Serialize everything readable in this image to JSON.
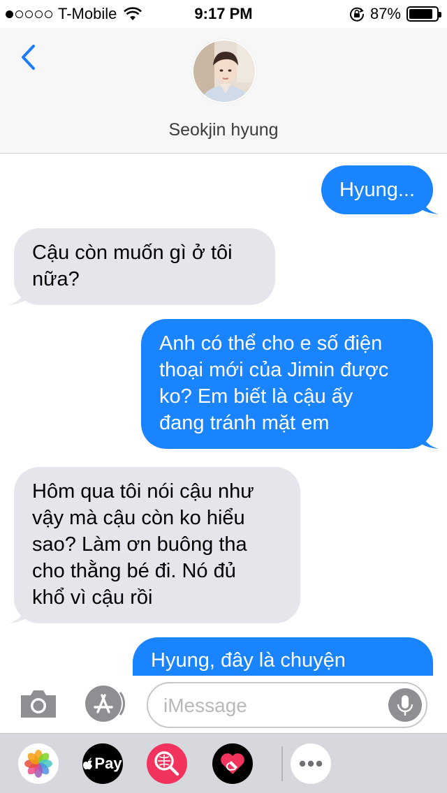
{
  "status_bar": {
    "carrier": "T-Mobile",
    "time": "9:17 PM",
    "battery": "87%",
    "battery_level": 0.87,
    "signal_bars": 1
  },
  "header": {
    "contact_name": "Seokjin hyung"
  },
  "messages": [
    {
      "direction": "out",
      "text": "Hyung..."
    },
    {
      "direction": "in",
      "text": "Cậu còn muốn gì ở tôi\nnữa?"
    },
    {
      "direction": "out",
      "text": "Anh có thể cho e số điện\nthoại mới của Jimin được\nko? Em biết là cậu ấy\nđang tránh mặt em"
    },
    {
      "direction": "in",
      "text": "Hôm qua tôi nói cậu như\nvậy mà cậu còn ko hiểu\nsao? Làm ơn buông tha\ncho thằng bé đi. Nó đủ\nkhổ vì cậu rồi"
    },
    {
      "direction": "out",
      "text": "Hyung, đây là chuyện"
    }
  ],
  "input": {
    "placeholder": "iMessage"
  },
  "app_drawer": {
    "apple_pay_label": "Pay",
    "icons": [
      "photos-icon",
      "apple-pay-icon",
      "web-search-icon",
      "digital-touch-icon",
      "more-icon"
    ]
  },
  "colors": {
    "outgoing_bubble": "#1a84ff",
    "incoming_bubble": "#e6e5eb",
    "accent": "#1a7bff"
  }
}
